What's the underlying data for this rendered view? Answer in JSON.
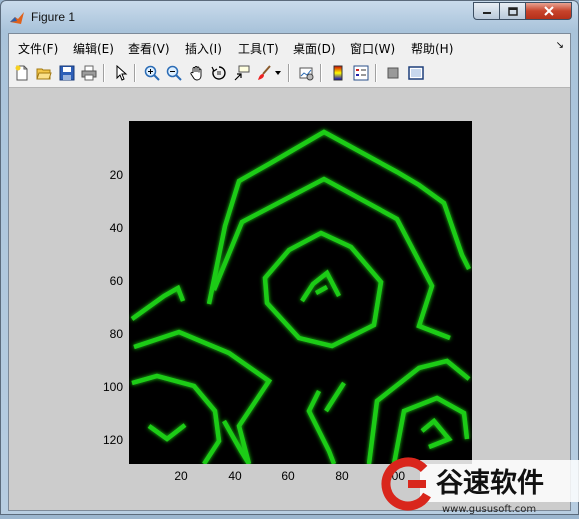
{
  "window": {
    "title": "Figure 1"
  },
  "menu": {
    "items": [
      "文件(F)",
      "编辑(E)",
      "查看(V)",
      "插入(I)",
      "工具(T)",
      "桌面(D)",
      "窗口(W)",
      "帮助(H)"
    ]
  },
  "toolbar": {
    "icons": [
      "new-figure-icon",
      "open-file-icon",
      "save-icon",
      "print-icon",
      "select-arrow-icon",
      "zoom-in-icon",
      "zoom-out-icon",
      "pan-hand-icon",
      "rotate-3d-icon",
      "data-cursor-icon",
      "brush-icon",
      "link-plot-icon",
      "colorbar-icon",
      "legend-icon",
      "hide-plot-tools-icon",
      "show-plot-tools-icon"
    ]
  },
  "axes": {
    "yticks": [
      "20",
      "40",
      "60",
      "80",
      "100",
      "120"
    ],
    "xticks": [
      "20",
      "40",
      "60",
      "80",
      "100"
    ]
  },
  "colors": {
    "ring": "#22d11a",
    "ring_glow": "#0f7a0b",
    "background": "#000000"
  },
  "watermark": {
    "brand": "谷速软件",
    "url": "www.gususoft.com"
  }
}
